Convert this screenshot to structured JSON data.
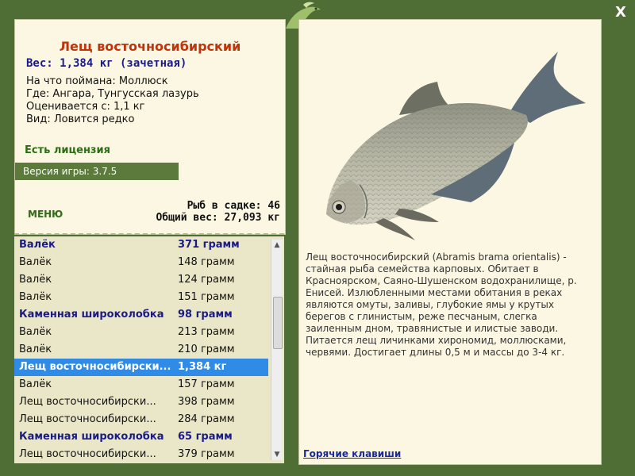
{
  "window": {
    "close_label": "X"
  },
  "fish": {
    "title": "Лещ восточносибирский",
    "weight_line": "Вес: 1,384 кг (зачетная)",
    "info": [
      "На что поймана: Моллюск",
      "Где: Ангара, Тунгусская лазурь",
      "Оценивается с: 1,1 кг",
      "Вид: Ловится редко"
    ],
    "license": "Есть лицензия",
    "description": "Лещ восточносибирский (Abramis brama orientalis) - стайная рыба семейства карповых. Обитает в Красноярском, Саяно-Шушенском водохранилище, р. Енисей. Излюбленными местами обитания в реках являются омуты, заливы, глубокие ямы у крутых берегов с глинистым, реже песчаным, слегка заиленным дном, травянистые и илистые заводи. Питается лещ личинками хирономид, моллюсками, червями. Достигает длины 0,5 м и массы до 3-4 кг."
  },
  "game": {
    "version": "Версия игры: 3.7.5",
    "menu_label": "МЕНЮ",
    "fish_in_net": "Рыб в садке: 46",
    "total_weight": "Общий вес: 27,093 кг",
    "hotkeys_label": "Горячие клавиши"
  },
  "catch_list": [
    {
      "name": "Валёк",
      "weight": "371 грамм",
      "type": "header"
    },
    {
      "name": "Валёк",
      "weight": "148 грамм",
      "type": "item"
    },
    {
      "name": "Валёк",
      "weight": "124 грамм",
      "type": "item"
    },
    {
      "name": "Валёк",
      "weight": "151 грамм",
      "type": "item"
    },
    {
      "name": "Каменная широколобка",
      "weight": "98 грамм",
      "type": "header"
    },
    {
      "name": "Валёк",
      "weight": "213 грамм",
      "type": "item"
    },
    {
      "name": "Валёк",
      "weight": "210 грамм",
      "type": "item"
    },
    {
      "name": "Лещ восточносибирски...",
      "weight": "1,384 кг",
      "type": "selected"
    },
    {
      "name": "Валёк",
      "weight": "157 грамм",
      "type": "item"
    },
    {
      "name": "Лещ восточносибирски...",
      "weight": "398 грамм",
      "type": "item"
    },
    {
      "name": "Лещ восточносибирски...",
      "weight": "284 грамм",
      "type": "item"
    },
    {
      "name": "Каменная широколобка",
      "weight": "65 грамм",
      "type": "header"
    },
    {
      "name": "Лещ восточносибирски...",
      "weight": "379 грамм",
      "type": "item"
    }
  ],
  "colors": {
    "frame": "#4f6e35",
    "panel": "#fbf7e2",
    "list_bg": "#eae7c8",
    "selected": "#2f8be6",
    "title": "#c0330b",
    "header_text": "#1b1b8a"
  },
  "icons": {
    "close": "close-icon",
    "logo": "fish-logo",
    "scroll_up": "chevron-up-icon",
    "scroll_down": "chevron-down-icon"
  }
}
